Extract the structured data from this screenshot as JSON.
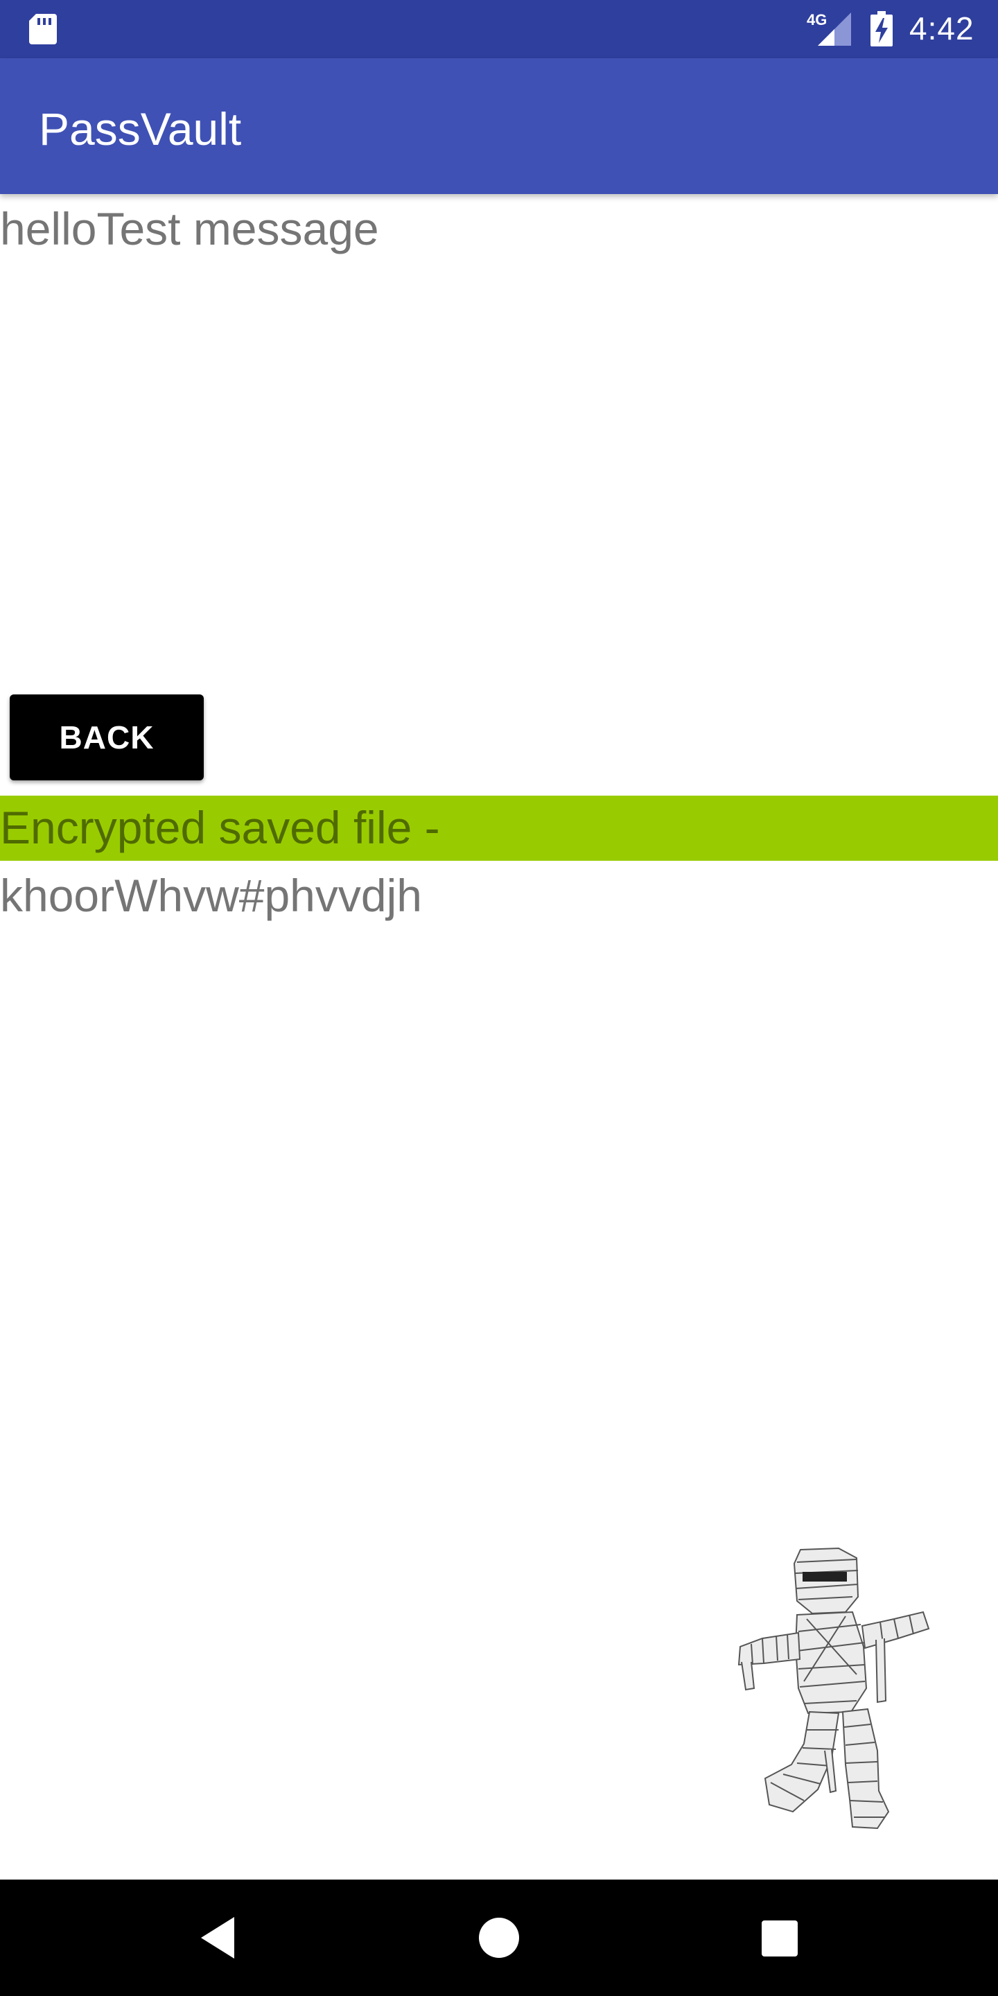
{
  "status_bar": {
    "network": "4G",
    "time": "4:42",
    "icons": [
      "sd-card-icon",
      "signal-icon",
      "battery-charging-icon"
    ]
  },
  "app_bar": {
    "title": "PassVault"
  },
  "content": {
    "message": "helloTest message",
    "back_label": "BACK",
    "encrypted_label": "Encrypted saved file -",
    "encrypted_value": "khoorWhvw#phvvdjh"
  },
  "colors": {
    "status_bar": "#2f3f9e",
    "app_bar": "#3f51b5",
    "banner": "#99cc00",
    "banner_text": "#4f6b00",
    "body_text": "#757575",
    "button": "#000000"
  },
  "nav_bar": {
    "icons": [
      "back-triangle-icon",
      "home-circle-icon",
      "recents-square-icon"
    ]
  }
}
